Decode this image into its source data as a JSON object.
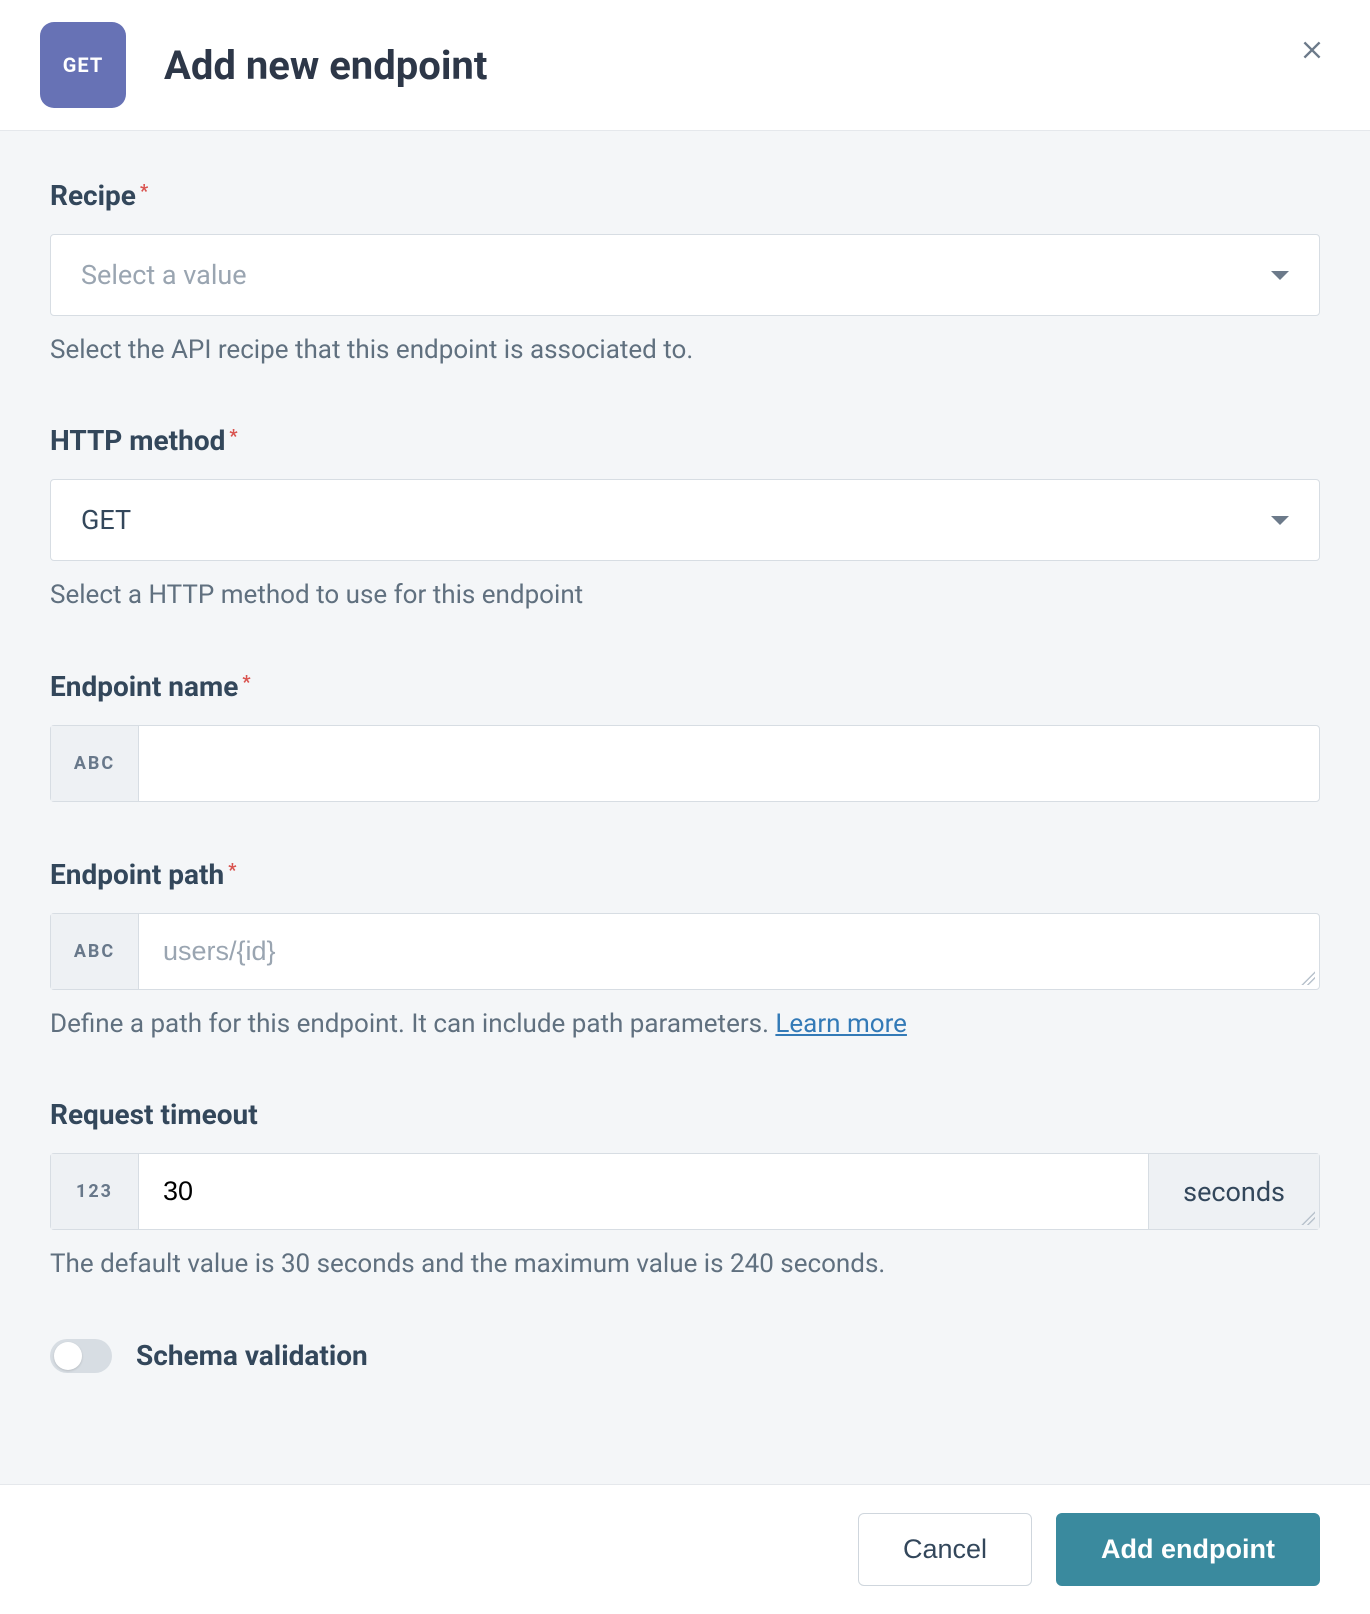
{
  "header": {
    "method_badge": "GET",
    "title": "Add new endpoint"
  },
  "fields": {
    "recipe": {
      "label": "Recipe",
      "placeholder": "Select a value",
      "help": "Select the API recipe that this endpoint is associated to."
    },
    "http_method": {
      "label": "HTTP method",
      "value": "GET",
      "help": "Select a HTTP method to use for this endpoint"
    },
    "endpoint_name": {
      "label": "Endpoint name",
      "prefix": "ABC",
      "value": ""
    },
    "endpoint_path": {
      "label": "Endpoint path",
      "prefix": "ABC",
      "placeholder": "users/{id}",
      "value": "",
      "help_pre": "Define a path for this endpoint. It can include path parameters. ",
      "learn_more": "Learn more"
    },
    "request_timeout": {
      "label": "Request timeout",
      "prefix": "123",
      "value": "30",
      "suffix": "seconds",
      "help": "The default value is 30 seconds and the maximum value is 240 seconds."
    },
    "schema_validation": {
      "label": "Schema validation",
      "enabled": false
    }
  },
  "footer": {
    "cancel": "Cancel",
    "submit": "Add endpoint"
  }
}
